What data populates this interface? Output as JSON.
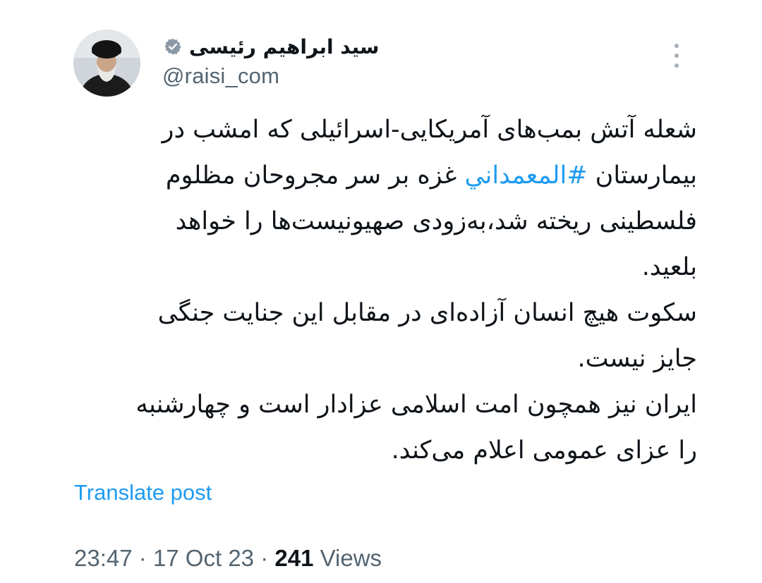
{
  "author": {
    "display_name": "سید ابراهیم رئیسی",
    "handle": "@raisi_com",
    "verified_icon": "verified-badge-icon",
    "avatar_icon": "avatar"
  },
  "tweet": {
    "lines_part1_before": "شعله آتش بمب‌های آمریکایی-اسرائیلی که امشب در بیمارستان ",
    "hashtag": "#المعمداني",
    "lines_part1_after": " غزه بر سر مجروحان مظلوم فلسطینی ریخته شد،به‌زودی صهیونیست‌ها را خواهد بلعید.",
    "paragraph2": "سکوت هیچ انسان آزاده‌ای در مقابل این جنایت جنگی جایز نیست.",
    "paragraph3": "ایران نیز همچون امت اسلامی عزادار است و چهارشنبه را عزای عمومی اعلام می‌کند."
  },
  "translate_label": "Translate post",
  "meta": {
    "time": "23:47",
    "separator": "·",
    "date": "17 Oct 23",
    "views_count": "241",
    "views_label": "Views"
  },
  "colors": {
    "link": "#1d9bf0",
    "secondary_text": "#536471",
    "primary_text": "#0f1419",
    "verified_badge": "#8b98a5"
  }
}
